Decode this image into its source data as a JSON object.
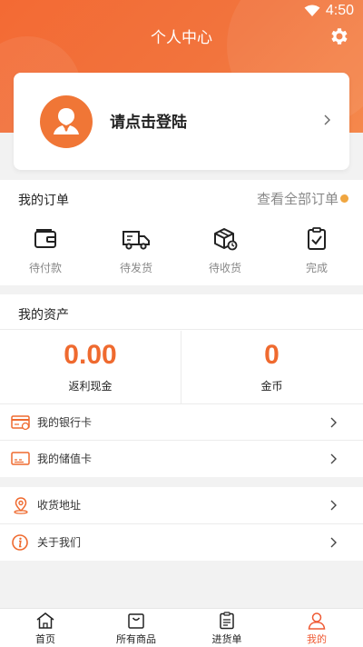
{
  "status_bar": {
    "time": "4:50"
  },
  "header": {
    "title": "个人中心"
  },
  "login": {
    "prompt": "请点击登陆"
  },
  "orders": {
    "title": "我的订单",
    "view_all": "查看全部订单",
    "items": [
      {
        "label": "待付款",
        "icon": "wallet-icon"
      },
      {
        "label": "待发货",
        "icon": "truck-icon"
      },
      {
        "label": "待收货",
        "icon": "package-icon"
      },
      {
        "label": "完成",
        "icon": "clipboard-check-icon"
      }
    ]
  },
  "assets": {
    "title": "我的资产",
    "cashback": {
      "value": "0.00",
      "label": "返利现金"
    },
    "coins": {
      "value": "0",
      "label": "金币"
    },
    "rows": [
      {
        "label": "我的银行卡",
        "icon": "bank-card-icon"
      },
      {
        "label": "我的储值卡",
        "icon": "stored-value-card-icon"
      }
    ]
  },
  "misc": {
    "rows": [
      {
        "label": "收货地址",
        "icon": "location-pin-icon"
      },
      {
        "label": "关于我们",
        "icon": "info-icon"
      }
    ]
  },
  "tabbar": {
    "items": [
      {
        "label": "首页",
        "icon": "home-icon"
      },
      {
        "label": "所有商品",
        "icon": "shopping-bag-icon"
      },
      {
        "label": "进货单",
        "icon": "order-list-icon"
      },
      {
        "label": "我的",
        "icon": "user-icon"
      }
    ],
    "active_index": 3
  },
  "colors": {
    "accent": "#ef6a2f",
    "header": "#f36a34",
    "active_tab": "#ef5a34"
  }
}
